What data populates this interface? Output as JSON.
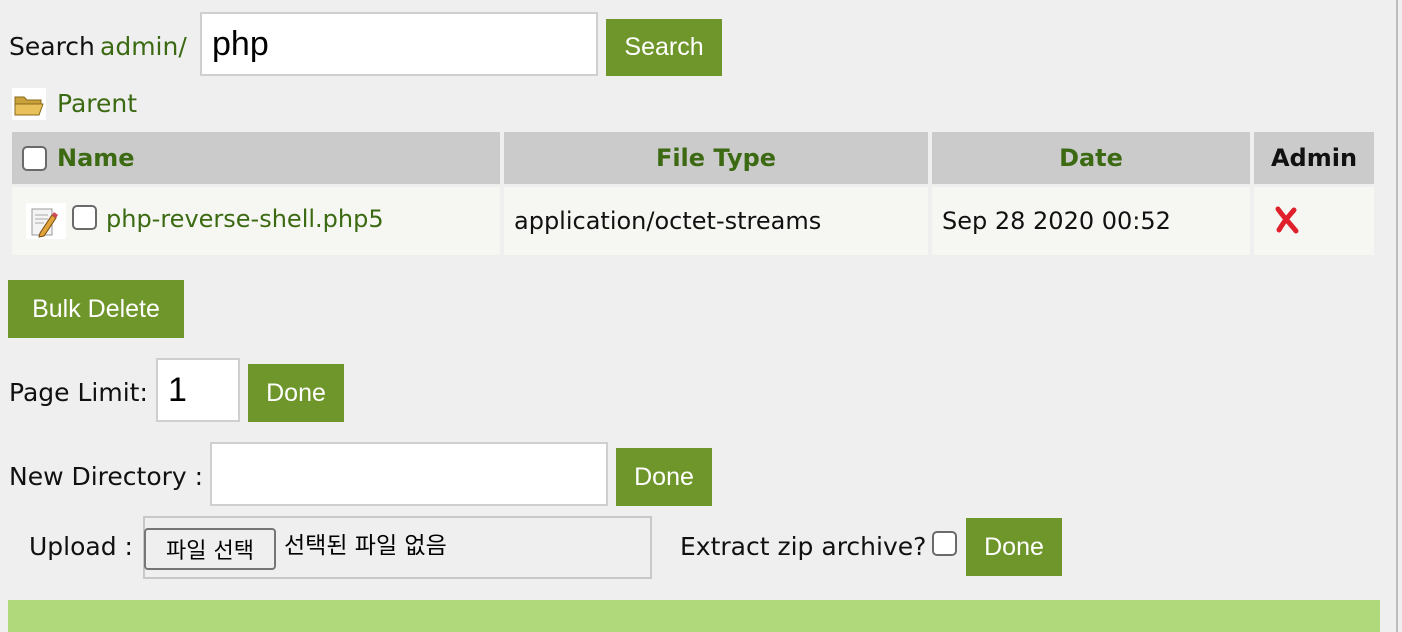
{
  "search": {
    "label": "Search",
    "path_link": "admin/",
    "query": "php",
    "button": "Search"
  },
  "parent": {
    "label": "Parent",
    "icon": "folder-open-icon"
  },
  "table": {
    "headers": {
      "name": "Name",
      "file_type": "File Type",
      "date": "Date",
      "admin": "Admin"
    },
    "rows": [
      {
        "name": "php-reverse-shell.php5",
        "file_type": "application/octet-streams",
        "date": "Sep 28 2020 00:52",
        "edit_icon": "edit-file-icon",
        "delete_icon": "delete-x-icon"
      }
    ]
  },
  "bulk_delete": {
    "button": "Bulk Delete"
  },
  "page_limit": {
    "label": "Page Limit:",
    "value": "1",
    "button": "Done"
  },
  "new_directory": {
    "label": "New Directory :",
    "value": "",
    "button": "Done"
  },
  "upload": {
    "label": "Upload :",
    "choose_button": "파일 선택",
    "status": "선택된 파일 없음",
    "extract_label": "Extract zip archive?",
    "button": "Done"
  },
  "colors": {
    "accent": "#6f962b",
    "link": "#3c6a12",
    "header_bg": "#cbcbcb",
    "row_bg": "#f6f7f2",
    "message_bg": "#b0d97c",
    "delete": "#e0202a"
  }
}
